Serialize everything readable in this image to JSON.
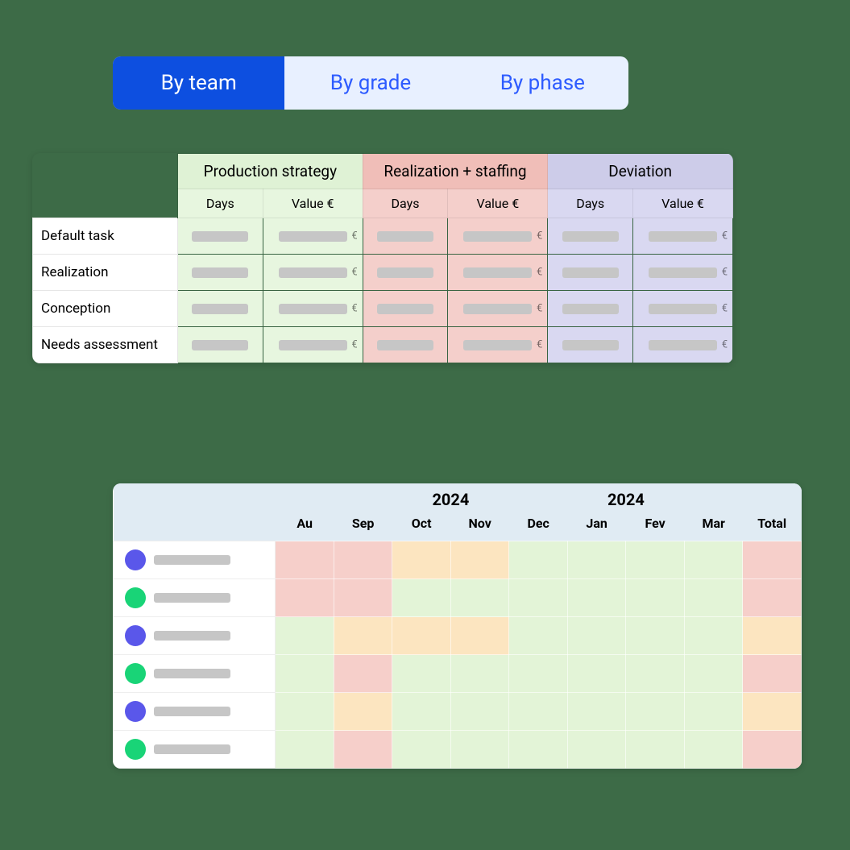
{
  "tabs": {
    "team": "By team",
    "grade": "By grade",
    "phase": "By phase",
    "active": "team"
  },
  "topTable": {
    "groups": [
      {
        "label": "Production strategy",
        "sub": [
          "Days",
          "Value €"
        ],
        "color": "green"
      },
      {
        "label": "Realization + staffing",
        "sub": [
          "Days",
          "Value €"
        ],
        "color": "red"
      },
      {
        "label": "Deviation",
        "sub": [
          "Days",
          "Value €"
        ],
        "color": "purple"
      }
    ],
    "rows": [
      "Default task",
      "Realization",
      "Conception",
      "Needs assessment"
    ],
    "currencySymbol": "€"
  },
  "bottomTable": {
    "yearLeft": "2024",
    "yearRight": "2024",
    "months": [
      "Au",
      "Sep",
      "Oct",
      "Nov",
      "Dec",
      "Jan",
      "Fev",
      "Mar",
      "Total"
    ],
    "rows": [
      {
        "avatar": "purple",
        "cells": [
          "red",
          "red",
          "orange",
          "orange",
          "green",
          "green",
          "green",
          "green",
          "red"
        ]
      },
      {
        "avatar": "green",
        "cells": [
          "red",
          "red",
          "green",
          "green",
          "green",
          "green",
          "green",
          "green",
          "red"
        ]
      },
      {
        "avatar": "purple",
        "cells": [
          "green",
          "orange",
          "orange",
          "orange",
          "green",
          "green",
          "green",
          "green",
          "orange"
        ]
      },
      {
        "avatar": "green",
        "cells": [
          "green",
          "red",
          "green",
          "green",
          "green",
          "green",
          "green",
          "green",
          "red"
        ]
      },
      {
        "avatar": "purple",
        "cells": [
          "green",
          "orange",
          "green",
          "green",
          "green",
          "green",
          "green",
          "green",
          "orange"
        ]
      },
      {
        "avatar": "green",
        "cells": [
          "green",
          "red",
          "green",
          "green",
          "green",
          "green",
          "green",
          "green",
          "red"
        ]
      }
    ]
  }
}
